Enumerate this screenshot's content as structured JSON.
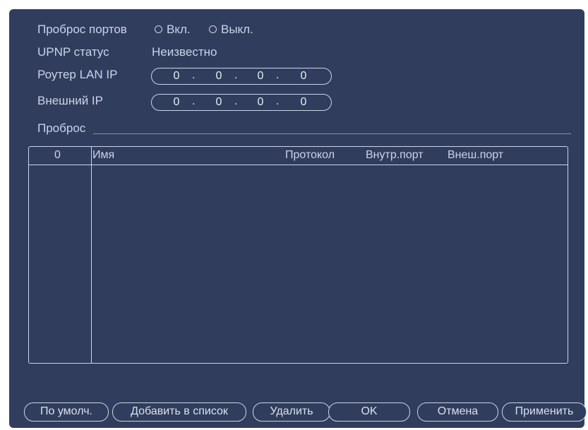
{
  "port_forwarding": {
    "label": "Проброс портов",
    "on_label": "Вкл.",
    "off_label": "Выкл."
  },
  "upnp_status": {
    "label": "UPNP статус",
    "value": "Неизвестно"
  },
  "router_lan_ip": {
    "label": "Роутер LAN IP",
    "octets": [
      "0",
      "0",
      "0",
      "0"
    ]
  },
  "external_ip": {
    "label": "Внешний IP",
    "octets": [
      "0",
      "0",
      "0",
      "0"
    ]
  },
  "forward_section": {
    "label": "Проброс"
  },
  "table": {
    "columns": [
      "0",
      "Имя",
      "Протокол",
      "Внутр.порт",
      "Внеш.порт"
    ],
    "rows": []
  },
  "buttons": {
    "default": "По умолч.",
    "add": "Добавить в список",
    "delete": "Удалить",
    "ok": "OK",
    "cancel": "Отмена",
    "apply": "Применить"
  },
  "colors": {
    "panel_bg": "#313d5c",
    "text": "#c9d4ea",
    "border": "#c9d4ea"
  }
}
